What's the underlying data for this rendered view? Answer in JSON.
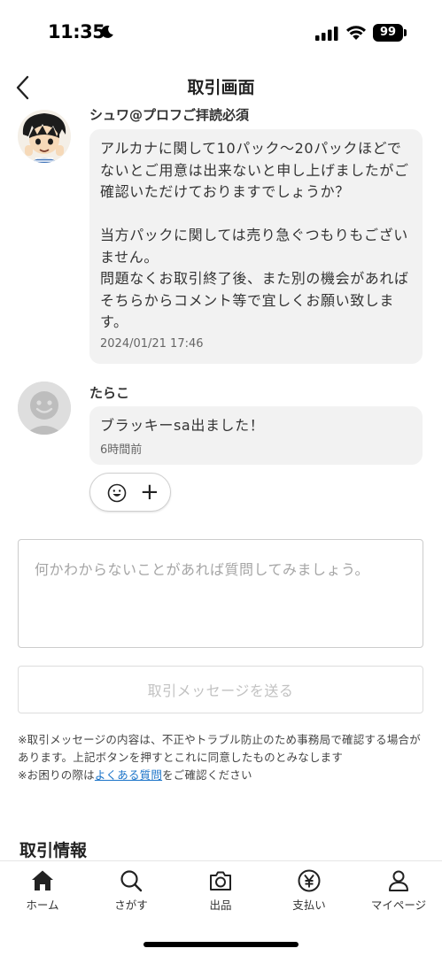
{
  "status_bar": {
    "time": "11:35",
    "battery": "99"
  },
  "header": {
    "title": "取引画面"
  },
  "messages": [
    {
      "sender": "シュワ@プロフご拝読必須",
      "text": "アルカナに関して10パック〜20パックほどでないとご用意は出来ないと申し上げましたがご確認いただけておりますでしょうか？\n\n当方パックに関しては売り急ぐつもりもございません。\n問題なくお取引終了後、また別の機会があればそちらからコメント等で宜しくお願い致します。",
      "time": "2024/01/21 17:46"
    },
    {
      "sender": "たらこ",
      "text": "ブラッキーsa出ました！",
      "time": "6時間前"
    }
  ],
  "reaction": {
    "add": "+"
  },
  "compose": {
    "placeholder": "何かわからないことがあれば質問してみましょう。",
    "send_label": "取引メッセージを送る"
  },
  "notice": {
    "line1": "※取引メッセージの内容は、不正やトラブル防止のため事務局で確認する場合があります。上記ボタンを押すとこれに同意したものとみなします",
    "line2_prefix": "※お困りの際は",
    "line2_link": "よくある質問",
    "line2_suffix": "をご確認ください"
  },
  "section": {
    "title": "取引情報"
  },
  "tabs": [
    {
      "label": "ホーム",
      "icon": "home-icon"
    },
    {
      "label": "さがす",
      "icon": "search-icon"
    },
    {
      "label": "出品",
      "icon": "camera-icon"
    },
    {
      "label": "支払い",
      "icon": "yen-icon"
    },
    {
      "label": "マイページ",
      "icon": "person-icon"
    }
  ],
  "colors": {
    "bubble": "#f2f2f2",
    "link": "#1a73c8",
    "text": "#222222"
  }
}
